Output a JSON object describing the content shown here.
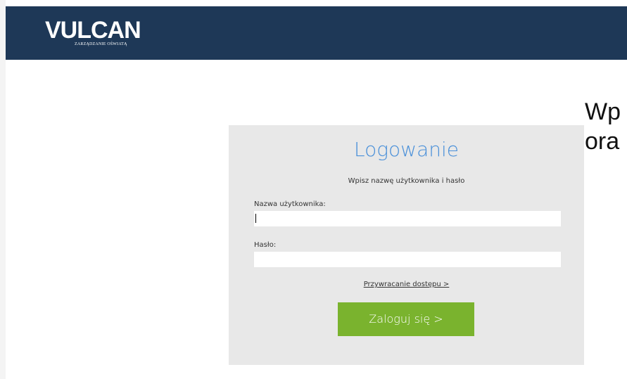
{
  "header": {
    "logo_text": "VULCAN",
    "logo_tagline": "ZARZĄDZANIE OŚWIATĄ",
    "background_color": "#1e3857"
  },
  "side_text": {
    "line1": "Wp",
    "line2": "ora"
  },
  "login": {
    "title": "Logowanie",
    "subtitle": "Wpisz nazwę użytkownika i hasło",
    "username_label": "Nazwa użytkownika:",
    "username_value": "",
    "password_label": "Hasło:",
    "password_value": "",
    "recover_link": "Przywracanie dostępu >",
    "submit_label": "Zaloguj się >",
    "title_color": "#4a90d9",
    "button_color": "#7ab32e",
    "panel_color": "#e8e8e8"
  }
}
